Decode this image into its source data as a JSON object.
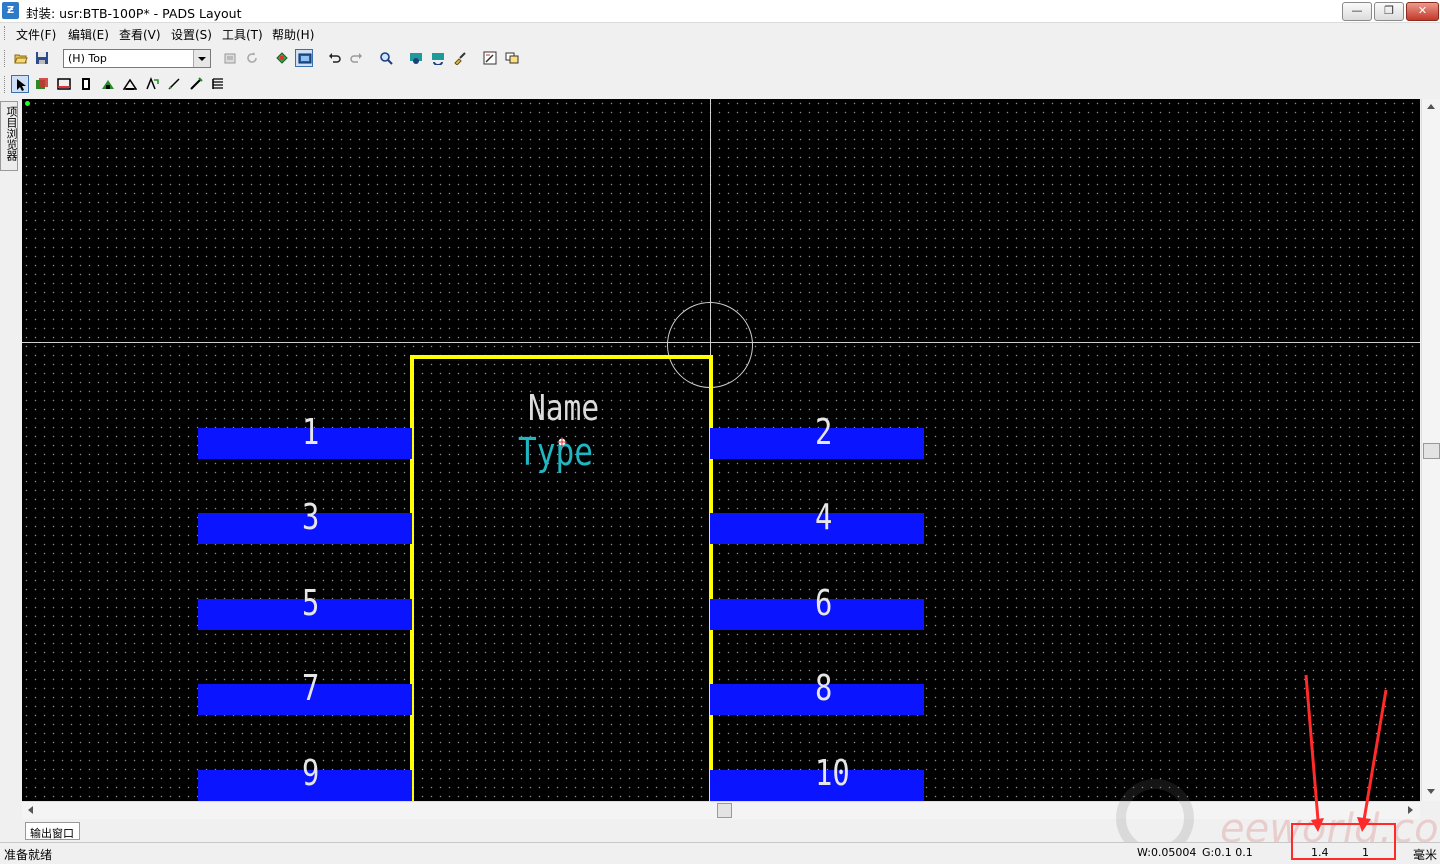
{
  "window": {
    "title": "封装: usr:BTB-100P* - PADS Layout",
    "app_icon_text": "Ƶ",
    "minimize": "—",
    "restore": "❐",
    "close": "✕"
  },
  "menu": [
    "文件(F)",
    "编辑(E)",
    "查看(V)",
    "设置(S)",
    "工具(T)",
    "帮助(H)"
  ],
  "toolbar": {
    "layer_select": "(H) Top"
  },
  "side_panel": {
    "label": "项目浏览器"
  },
  "canvas": {
    "part_name_label": "Name",
    "part_type_label": "Type",
    "pins": [
      "1",
      "2",
      "3",
      "4",
      "5",
      "6",
      "7",
      "8",
      "9",
      "10"
    ],
    "colors": {
      "background": "#000000",
      "pad": "#0a14ff",
      "outline": "#ffff00",
      "type_label": "#1fb7c2",
      "grid_dot": "#8a8a8a"
    }
  },
  "output_window": {
    "tab_label": "输出窗口"
  },
  "status": {
    "ready": "准备就绪",
    "width": "W:0.05004",
    "grid": "G:0.1 0.1",
    "x": "1.4",
    "y": "1",
    "units": "毫米"
  },
  "watermark": {
    "text": "eeworld.com.cn"
  }
}
